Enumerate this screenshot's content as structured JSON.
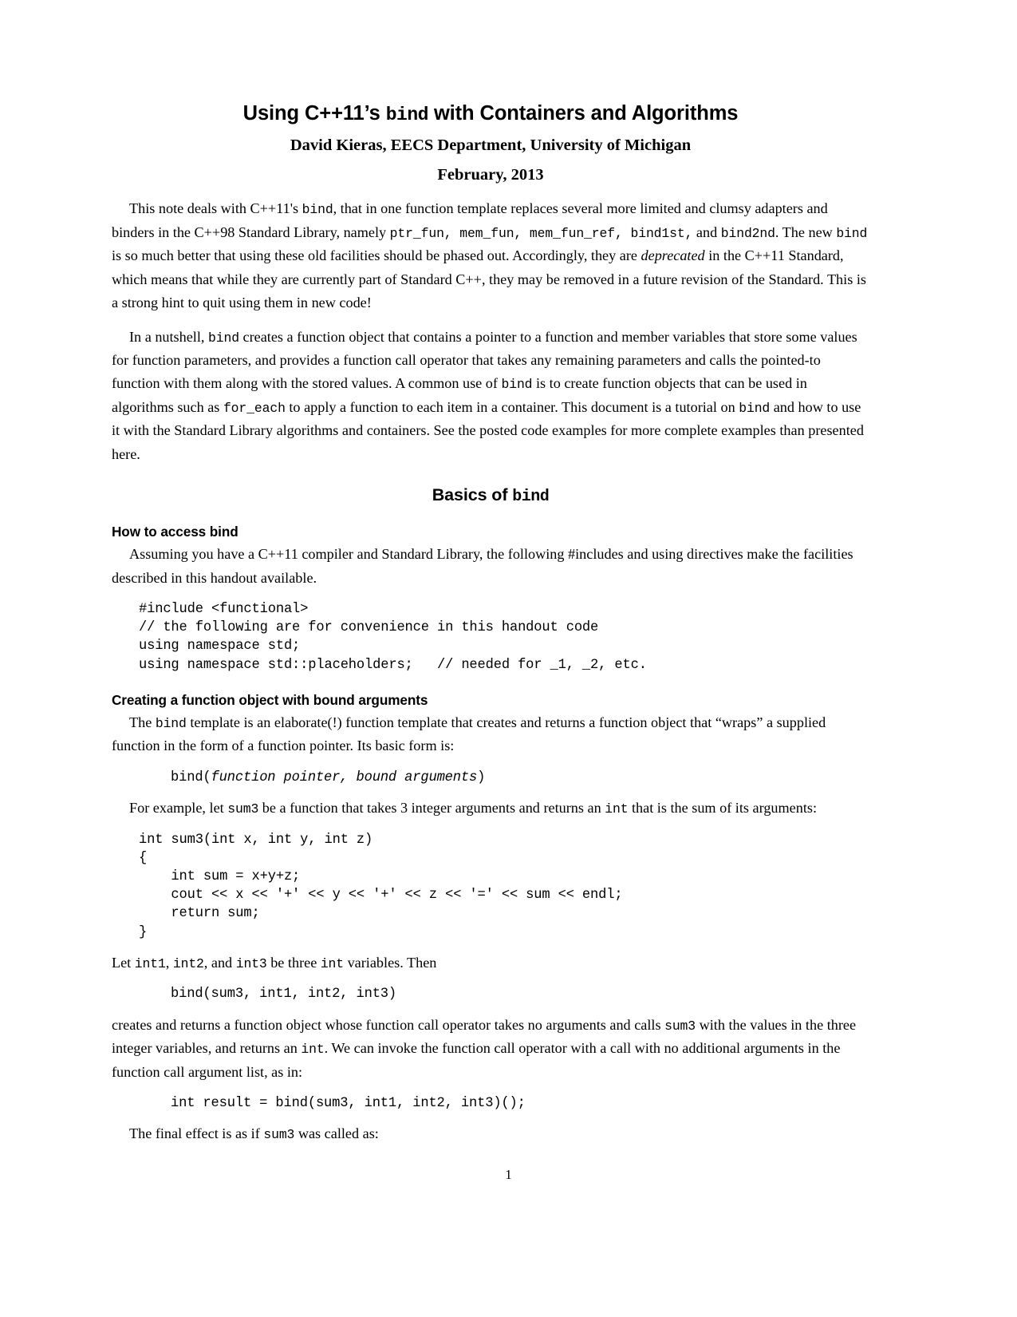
{
  "document": {
    "title_prefix": "Using C++11’s ",
    "title_mono": "bind",
    "title_suffix": " with Containers and Algorithms",
    "author_line": "David Kieras, EECS Department, University of Michigan",
    "date_line": "February, 2013",
    "page_number": "1"
  },
  "intro": {
    "para1_a": "This note deals with C++11's ",
    "para1_m1": "bind",
    "para1_b": ", that in one function template replaces several more limited and clumsy adapters and binders in the C++98 Standard Library, namely ",
    "para1_m2": "ptr_fun, mem_fun, mem_fun_ref, bind1st,",
    "para1_c": " and ",
    "para1_m3": " bind2nd",
    "para1_d": ". The new ",
    "para1_m4": "bind",
    "para1_e": " is so much better that using these old facilities should be phased out. Accordingly, they are ",
    "para1_i1": "deprecated",
    "para1_f": " in the C++11 Standard, which means that while they are currently part of Standard C++, they may be removed in a future revision of the Standard. This is a strong hint to quit using them in new code!",
    "para2_a": "In a nutshell, ",
    "para2_m1": "bind",
    "para2_b": " creates a function object that contains a pointer to a function and member variables that store some values for function parameters, and provides a function call operator that takes any remaining parameters and calls the pointed-to function with them along with the stored values. A common use of ",
    "para2_m2": "bind",
    "para2_c": " is to create function objects that can be used in algorithms such as ",
    "para2_m3": "for_each",
    "para2_d": " to apply a function to each item in a container.   This document is a tutorial on ",
    "para2_m4": "bind",
    "para2_e": " and how to use it with the Standard Library algorithms and containers. See the posted code examples for more complete examples than presented here."
  },
  "basics": {
    "heading_prefix": "Basics of ",
    "heading_mono": "bind"
  },
  "access": {
    "subheading": "How to access bind",
    "para_a": "Assuming you have a C++11 compiler and Standard Library, the following #includes and using directives make the facilities described in this handout available.",
    "code": "#include <functional>\n// the following are for convenience in this handout code\nusing namespace std;\nusing namespace std::placeholders;   // needed for _1, _2, etc."
  },
  "creating": {
    "subheading": "Creating a function object with bound arguments",
    "para_a": "The ",
    "para_m1": "bind",
    "para_b": " template is an elaborate(!) function template that creates and returns a function object that “wraps” a supplied function in the form of a function pointer. Its basic form is:",
    "form_prefix": "bind(",
    "form_italic": "function pointer, bound arguments",
    "form_suffix": ")",
    "example_a": "For example, let ",
    "example_m1": "sum3",
    "example_b": " be a function that takes 3 integer arguments and returns an ",
    "example_m2": "int",
    "example_c": " that is the sum of its arguments:",
    "sum3_code": "int sum3(int x, int y, int z)\n{\n    int sum = x+y+z;\n    cout << x << '+' << y << '+' << z << '=' << sum << endl;\n    return sum;\n}",
    "let_a": "Let ",
    "let_m1": "int1",
    "let_b": ", ",
    "let_m2": "int2",
    "let_c": ", and ",
    "let_m3": "int3",
    "let_d": " be three ",
    "let_m4": "int",
    "let_e": " variables. Then",
    "bind_call": "bind(sum3, int1, int2, int3)",
    "creates_a": "creates and returns a function object whose function call operator takes no arguments and calls ",
    "creates_m1": "sum3",
    "creates_b": " with the values in the three integer variables, and returns an ",
    "creates_m2": "int",
    "creates_c": ". We can invoke the function call operator with a call with no additional arguments in the function call argument list, as in:",
    "result_call": "int result = bind(sum3, int1, int2, int3)();",
    "final_a": "The final effect is as if ",
    "final_m1": "sum3",
    "final_b": " was called as:"
  }
}
